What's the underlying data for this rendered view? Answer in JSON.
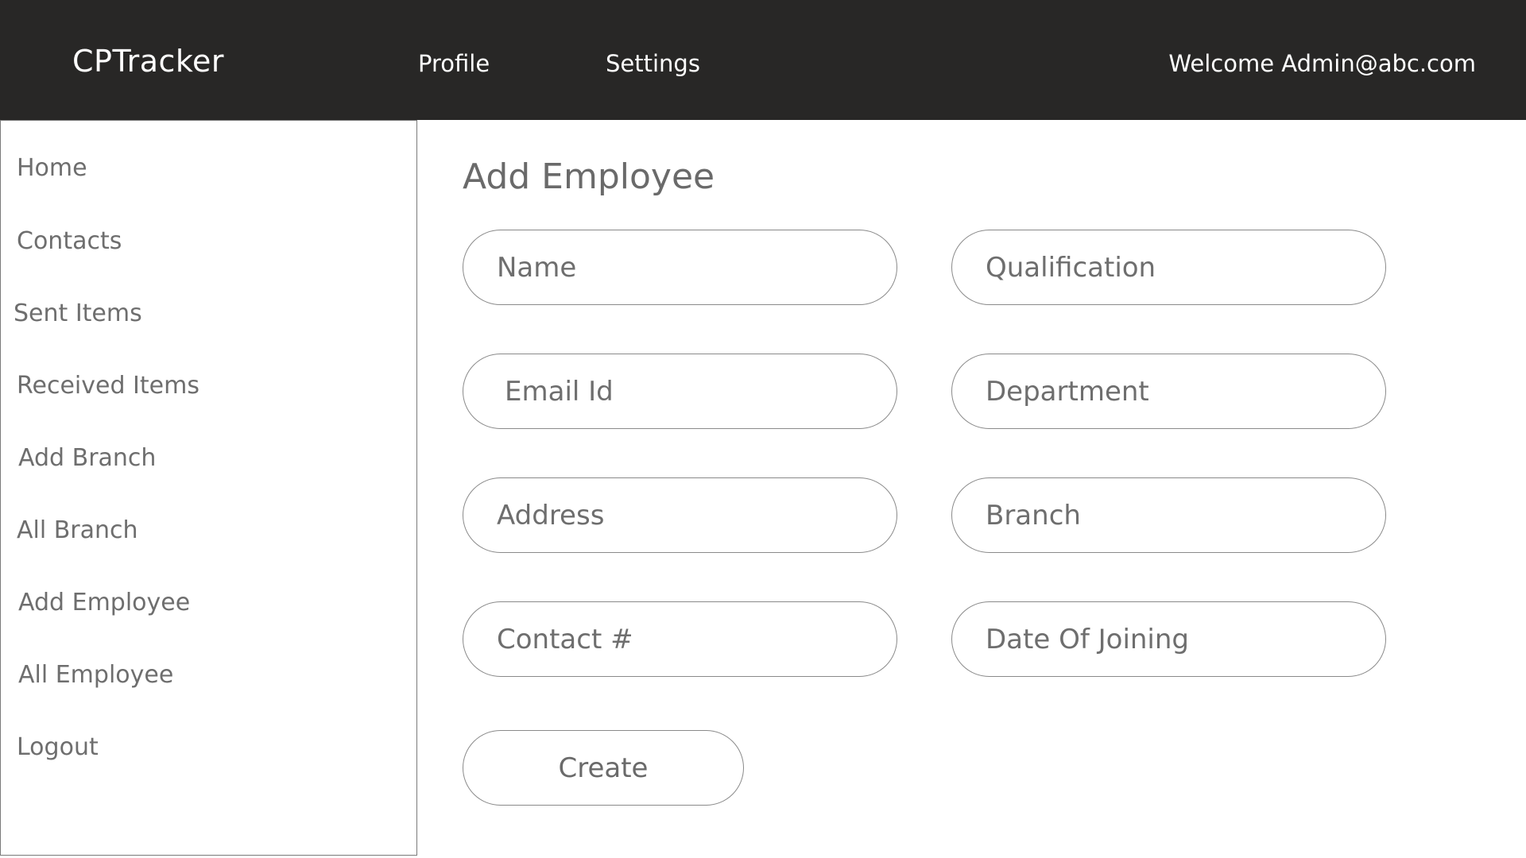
{
  "header": {
    "brand": "CPTracker",
    "nav": {
      "profile": "Profile",
      "settings": "Settings"
    },
    "welcome": "Welcome Admin@abc.com"
  },
  "sidebar": {
    "items": [
      {
        "label": "Home"
      },
      {
        "label": "Contacts"
      },
      {
        "label": "Sent Items"
      },
      {
        "label": "Received Items"
      },
      {
        "label": "Add Branch"
      },
      {
        "label": "All Branch"
      },
      {
        "label": "Add Employee"
      },
      {
        "label": "All Employee"
      },
      {
        "label": "Logout"
      }
    ]
  },
  "main": {
    "title": "Add Employee",
    "fields": {
      "name": {
        "placeholder": "Name",
        "value": ""
      },
      "qualification": {
        "placeholder": "Qualification",
        "value": ""
      },
      "email": {
        "placeholder": "Email Id",
        "value": ""
      },
      "department": {
        "placeholder": "Department",
        "value": ""
      },
      "address": {
        "placeholder": "Address",
        "value": ""
      },
      "branch": {
        "placeholder": "Branch",
        "value": ""
      },
      "contact": {
        "placeholder": "Contact #",
        "value": ""
      },
      "date_of_joining": {
        "placeholder": "Date Of Joining",
        "value": ""
      }
    },
    "create_label": "Create"
  },
  "colors": {
    "header_bg": "#282726",
    "header_text": "#ffffff",
    "body_text": "#6e6e6e",
    "border": "#8a8a8a"
  }
}
